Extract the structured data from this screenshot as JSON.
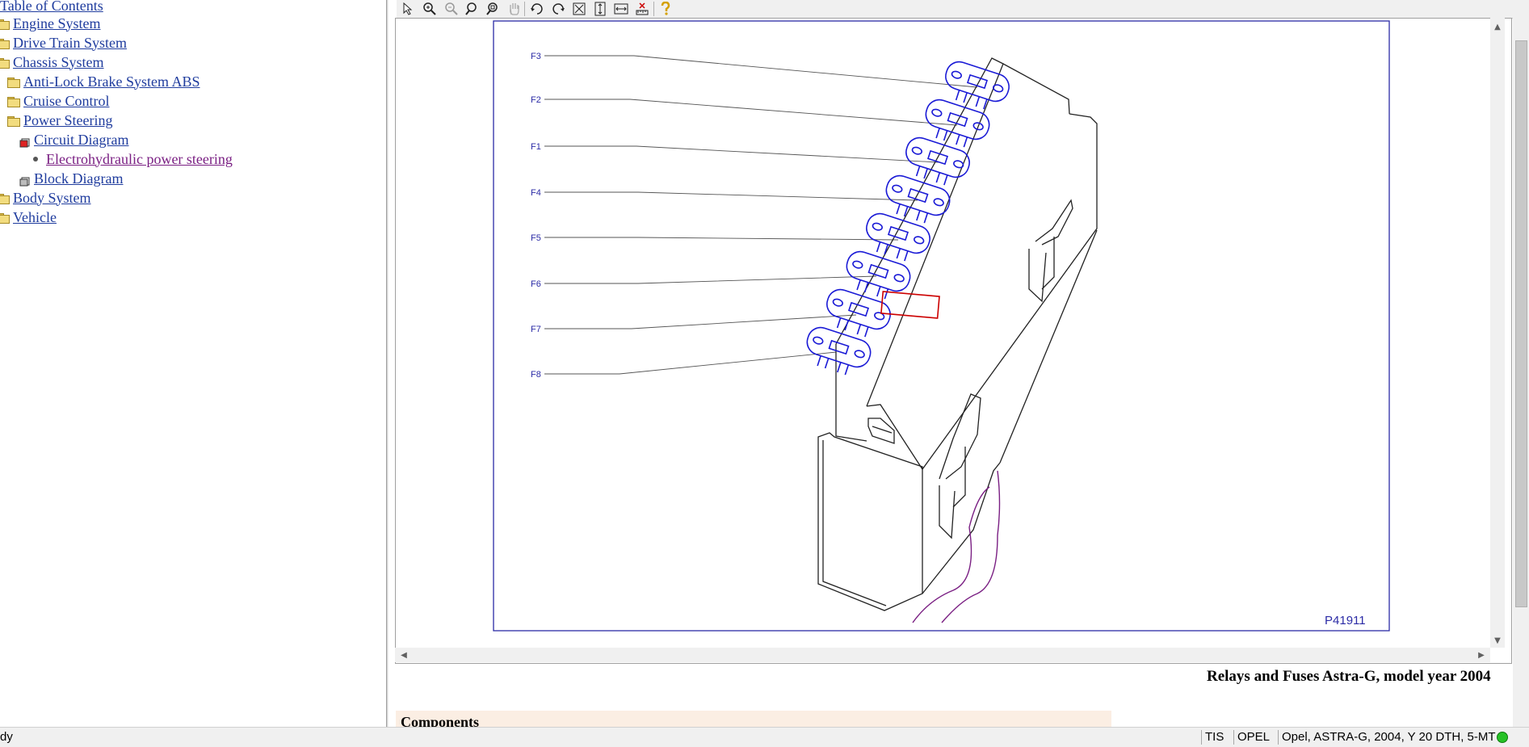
{
  "tree": {
    "root_label": "Table of Contents",
    "items": [
      {
        "label": "Engine System"
      },
      {
        "label": "Drive Train System"
      },
      {
        "label": "Chassis System"
      },
      {
        "label": "Anti-Lock Brake System ABS"
      },
      {
        "label": "Cruise Control"
      },
      {
        "label": "Power Steering"
      },
      {
        "label": "Circuit Diagram"
      },
      {
        "label": "Electrohydraulic power steering"
      },
      {
        "label": "Block Diagram"
      },
      {
        "label": "Body System"
      },
      {
        "label": "Vehicle"
      }
    ]
  },
  "toolbar": {
    "icons": [
      "select-arrow",
      "zoom-in",
      "zoom-out",
      "zoom",
      "zoom-window",
      "pan-hand",
      "rotate-left",
      "rotate-right",
      "fit-all",
      "fit-height",
      "fit-width",
      "measure",
      "help"
    ]
  },
  "drawing": {
    "fuse_labels": [
      "F3",
      "F2",
      "F1",
      "F4",
      "F5",
      "F6",
      "F7",
      "F8"
    ],
    "figure_id": "P41911",
    "colors": {
      "outline": "#2b2ba6",
      "highlight": "#cc0000",
      "wire": "#7a1f83",
      "fuse": "#1a1ad6"
    }
  },
  "document": {
    "title": "Relays and Fuses Astra-G, model year 2004",
    "section_heading": "Components"
  },
  "status": {
    "left_text": "dy",
    "system": "TIS",
    "brand": "OPEL",
    "vehicle": "Opel, ASTRA-G, 2004, Y 20 DTH, 5-MT"
  }
}
